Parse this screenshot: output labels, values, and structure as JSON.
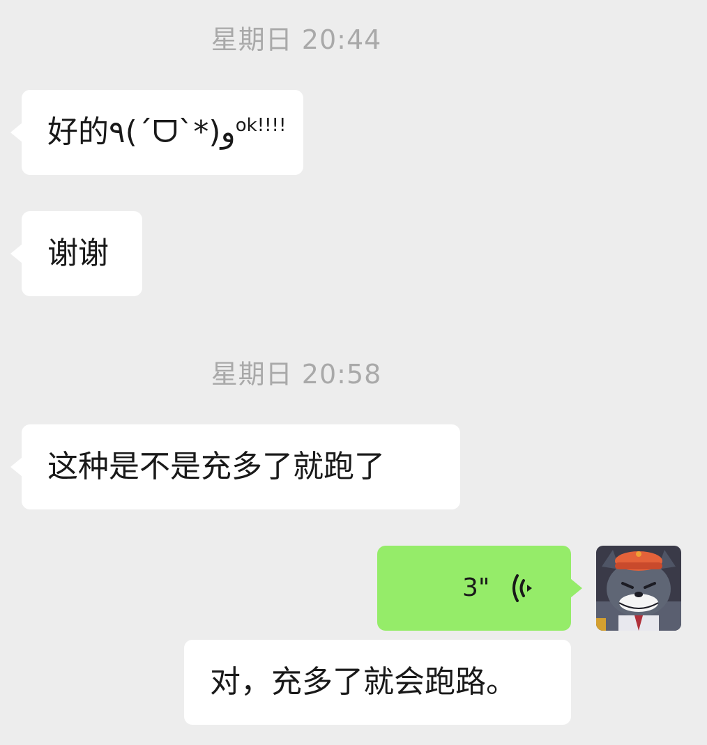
{
  "timestamps": [
    "星期日 20:44",
    "星期日 20:58"
  ],
  "messages": [
    {
      "text": "好的٩(ˊᗜˋ*)و",
      "suffix": "ok!!!!"
    },
    {
      "text": "谢谢"
    },
    {
      "text": "这种是不是充多了就跑了"
    },
    {
      "voice_duration": "3\""
    },
    {
      "text": "对，充多了就会跑路。"
    }
  ],
  "icons": {
    "voice": "voice-wave-icon",
    "avatar": "cartoon-wolf-avatar"
  },
  "colors": {
    "background": "#ededed",
    "incoming_bubble": "#ffffff",
    "outgoing_bubble": "#95ec69",
    "timestamp_text": "#a9a9a9",
    "message_text": "#191919"
  }
}
